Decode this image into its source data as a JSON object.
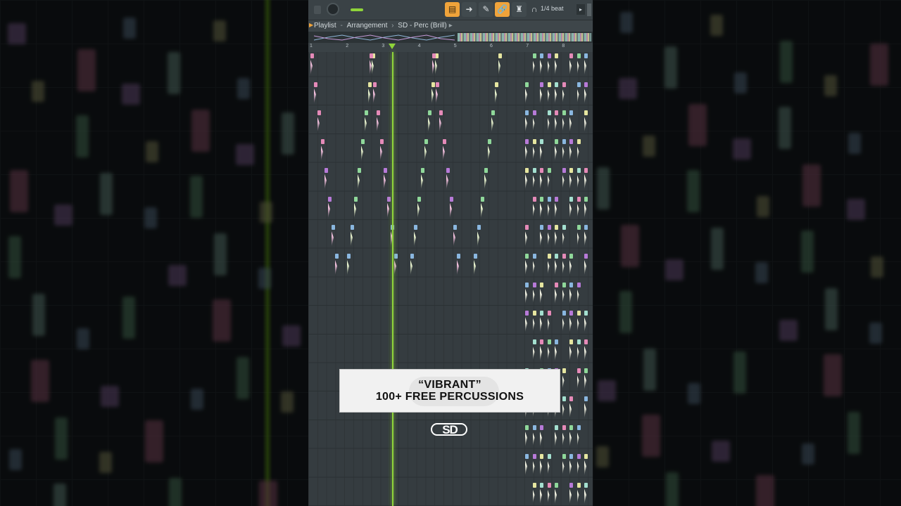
{
  "toolbar": {
    "snap_label": "1/4 beat",
    "buttons": [
      {
        "name": "playlist-button",
        "glyph": "▤",
        "active": true
      },
      {
        "name": "arrow-button",
        "glyph": "➜",
        "active": false
      },
      {
        "name": "brush-button",
        "glyph": "✎",
        "active": false
      },
      {
        "name": "link-button",
        "glyph": "🔗",
        "active": true
      },
      {
        "name": "stamp-button",
        "glyph": "♜",
        "active": false
      }
    ],
    "magnet_icon": "magnet-icon",
    "scroll_right_glyph": "▸"
  },
  "titlebar": {
    "window": "Playlist",
    "view": "Arrangement",
    "pattern": "SD - Perc (Brill)",
    "arrow_glyph": "▸"
  },
  "ruler": {
    "bars": [
      "1",
      "2",
      "3",
      "4",
      "5",
      "6",
      "7",
      "8"
    ]
  },
  "colors": {
    "playhead": "#8fd43a",
    "accent": "#f0a33a",
    "clip_pink": "#e58ab8",
    "clip_purple": "#b77ad8",
    "clip_green": "#8fd89a",
    "clip_blue": "#8ab7e0",
    "clip_yellow": "#e6e6a0"
  },
  "overlay": {
    "line1": "“VIBRANT”",
    "line2": "100+ FREE PERCUSSIONS",
    "logo": "SD"
  }
}
